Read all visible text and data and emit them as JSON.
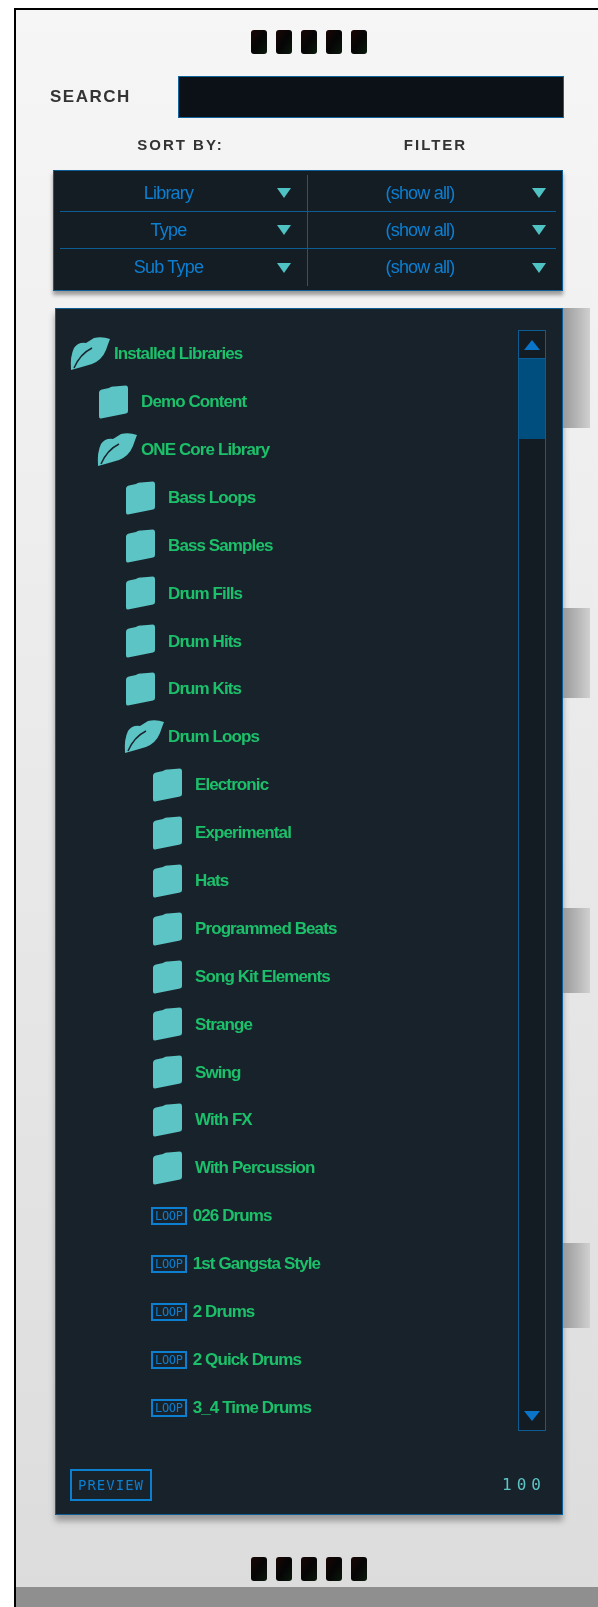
{
  "search": {
    "label": "SEARCH"
  },
  "sort_label": "SORT BY:",
  "filter_label": "FILTER",
  "dropdowns": [
    {
      "sort": "Library",
      "filter": "(show all)"
    },
    {
      "sort": "Type",
      "filter": "(show all)"
    },
    {
      "sort": "Sub Type",
      "filter": "(show all)"
    }
  ],
  "tree": [
    {
      "kind": "folder",
      "label": "Installed Libraries",
      "expanded": true,
      "children": [
        {
          "kind": "folder",
          "label": "Demo Content",
          "expanded": false
        },
        {
          "kind": "folder",
          "label": "ONE Core Library",
          "expanded": true,
          "children": [
            {
              "kind": "folder",
              "label": "Bass Loops",
              "expanded": false
            },
            {
              "kind": "folder",
              "label": "Bass Samples",
              "expanded": false
            },
            {
              "kind": "folder",
              "label": "Drum Fills",
              "expanded": false
            },
            {
              "kind": "folder",
              "label": "Drum Hits",
              "expanded": false
            },
            {
              "kind": "folder",
              "label": "Drum Kits",
              "expanded": false
            },
            {
              "kind": "folder",
              "label": "Drum Loops",
              "expanded": true,
              "children": [
                {
                  "kind": "folder",
                  "label": "Electronic",
                  "expanded": false
                },
                {
                  "kind": "folder",
                  "label": "Experimental",
                  "expanded": false
                },
                {
                  "kind": "folder",
                  "label": "Hats",
                  "expanded": false
                },
                {
                  "kind": "folder",
                  "label": "Programmed Beats",
                  "expanded": false
                },
                {
                  "kind": "folder",
                  "label": "Song Kit Elements",
                  "expanded": false
                },
                {
                  "kind": "folder",
                  "label": "Strange",
                  "expanded": false
                },
                {
                  "kind": "folder",
                  "label": "Swing",
                  "expanded": false
                },
                {
                  "kind": "folder",
                  "label": "With FX",
                  "expanded": false
                },
                {
                  "kind": "folder",
                  "label": "With Percussion",
                  "expanded": false
                },
                {
                  "kind": "loop",
                  "badge": "LOOP",
                  "label": "026 Drums"
                },
                {
                  "kind": "loop",
                  "badge": "LOOP",
                  "label": "1st Gangsta Style"
                },
                {
                  "kind": "loop",
                  "badge": "LOOP",
                  "label": "2 Drums"
                },
                {
                  "kind": "loop",
                  "badge": "LOOP",
                  "label": "2 Quick Drums"
                },
                {
                  "kind": "loop",
                  "badge": "LOOP",
                  "label": "3_4 Time Drums"
                }
              ]
            }
          ]
        }
      ]
    }
  ],
  "preview_button": "PREVIEW",
  "volume": "100"
}
